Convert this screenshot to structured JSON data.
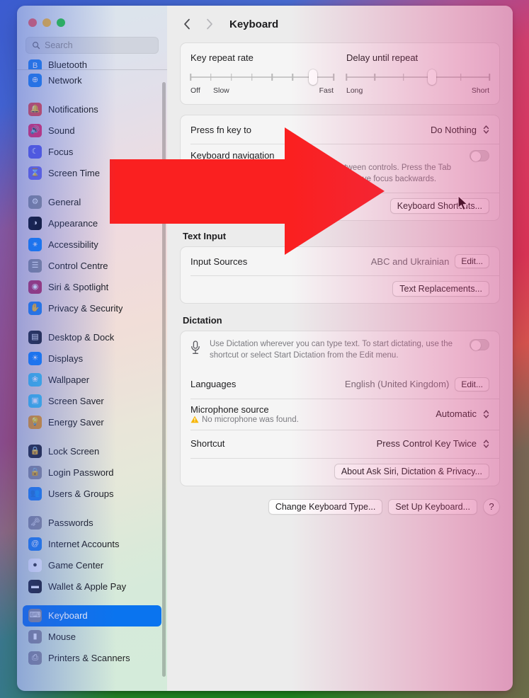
{
  "window": {
    "traffic_lights": [
      "close",
      "minimize",
      "zoom"
    ],
    "accent_color": "#0a74ef",
    "annotation_color": "#fa2020"
  },
  "sidebar": {
    "search": {
      "placeholder": "Search",
      "icon": "search-icon"
    },
    "items": [
      {
        "label": "Bluetooth",
        "icon": "bluetooth-icon",
        "color": "#1b82f0",
        "glyph": "B",
        "clipped": true
      },
      {
        "label": "Network",
        "icon": "globe-icon",
        "color": "#1b82f0",
        "glyph": "⊕"
      },
      {
        "gap": true
      },
      {
        "label": "Notifications",
        "icon": "bell-icon",
        "color": "#f0453f",
        "glyph": "🔔"
      },
      {
        "label": "Sound",
        "icon": "speaker-icon",
        "color": "#f4255e",
        "glyph": "🔊"
      },
      {
        "label": "Focus",
        "icon": "moon-icon",
        "color": "#5a58e8",
        "glyph": "☾"
      },
      {
        "label": "Screen Time",
        "icon": "hourglass-icon",
        "color": "#6a63e8",
        "glyph": "⌛"
      },
      {
        "gap": true
      },
      {
        "label": "General",
        "icon": "gear-icon",
        "color": "#8e8e93",
        "glyph": "⚙"
      },
      {
        "label": "Appearance",
        "icon": "appearance-icon",
        "color": "#000000",
        "glyph": "◑"
      },
      {
        "label": "Accessibility",
        "icon": "accessibility-icon",
        "color": "#0a84ff",
        "glyph": "⚹"
      },
      {
        "label": "Control Centre",
        "icon": "control-centre-icon",
        "color": "#8e8e93",
        "glyph": "☰"
      },
      {
        "label": "Siri & Spotlight",
        "icon": "siri-icon",
        "color": "#c0285a",
        "glyph": "◉"
      },
      {
        "label": "Privacy & Security",
        "icon": "privacy-hand-icon",
        "color": "#1b82f0",
        "glyph": "✋"
      },
      {
        "gap": true
      },
      {
        "label": "Desktop & Dock",
        "icon": "desktop-dock-icon",
        "color": "#1c1c1e",
        "glyph": "▤"
      },
      {
        "label": "Displays",
        "icon": "display-icon",
        "color": "#0a84ff",
        "glyph": "☀"
      },
      {
        "label": "Wallpaper",
        "icon": "wallpaper-icon",
        "color": "#3ec8f0",
        "glyph": "❀"
      },
      {
        "label": "Screen Saver",
        "icon": "screen-saver-icon",
        "color": "#3ec8f0",
        "glyph": "▣"
      },
      {
        "label": "Energy Saver",
        "icon": "energy-saver-icon",
        "color": "#f99a0b",
        "glyph": "💡"
      },
      {
        "gap": true
      },
      {
        "label": "Lock Screen",
        "icon": "lock-screen-icon",
        "color": "#1c1c1e",
        "glyph": "🔒"
      },
      {
        "label": "Login Password",
        "icon": "login-password-icon",
        "color": "#8e8e93",
        "glyph": "🔒"
      },
      {
        "label": "Users & Groups",
        "icon": "users-groups-icon",
        "color": "#1b82f0",
        "glyph": "👥"
      },
      {
        "gap": true
      },
      {
        "label": "Passwords",
        "icon": "key-icon",
        "color": "#8e8e93",
        "glyph": "🗝"
      },
      {
        "label": "Internet Accounts",
        "icon": "at-sign-icon",
        "color": "#1b82f0",
        "glyph": "@"
      },
      {
        "label": "Game Center",
        "icon": "game-center-icon",
        "color": "#ffffff",
        "glyph": "●"
      },
      {
        "label": "Wallet & Apple Pay",
        "icon": "wallet-icon",
        "color": "#1c1c1e",
        "glyph": "▬"
      },
      {
        "gap": true
      },
      {
        "label": "Keyboard",
        "icon": "keyboard-icon",
        "color": "#8e8e93",
        "glyph": "⌨",
        "selected": true
      },
      {
        "label": "Mouse",
        "icon": "mouse-icon",
        "color": "#8e8e93",
        "glyph": "▮"
      },
      {
        "label": "Printers & Scanners",
        "icon": "printer-icon",
        "color": "#8e8e93",
        "glyph": "⎙"
      }
    ]
  },
  "header": {
    "title": "Keyboard",
    "back_icon": "chevron-left-icon",
    "forward_icon": "chevron-right-icon"
  },
  "main": {
    "sliders": [
      {
        "title": "Key repeat rate",
        "left_caption": "Off",
        "second_caption": "Slow",
        "right_caption": "Fast",
        "ticks": 8,
        "value_index": 6
      },
      {
        "title": "Delay until repeat",
        "left_caption": "Long",
        "second_caption": "",
        "right_caption": "Short",
        "ticks": 6,
        "value_index": 3
      }
    ],
    "fn_row": {
      "label": "Press fn key to",
      "value": "Do Nothing"
    },
    "keyboard_navigation": {
      "title": "Keyboard navigation",
      "description": "Use keyboard navigation to move focus between controls. Press the Tab key to move focus forwards and Shift-Tab to move focus backwards.",
      "toggle_state": "off"
    },
    "keyboard_shortcuts_button": "Keyboard Shortcuts...",
    "text_input": {
      "section_title": "Text Input",
      "input_sources_label": "Input Sources",
      "input_sources_value": "ABC and Ukrainian",
      "edit_button": "Edit...",
      "text_replacements_button": "Text Replacements..."
    },
    "dictation": {
      "section_title": "Dictation",
      "description": "Use Dictation wherever you can type text. To start dictating, use the shortcut or select Start Dictation from the Edit menu.",
      "toggle_state": "off",
      "mic_icon": "microphone-icon",
      "languages_label": "Languages",
      "languages_value": "English (United Kingdom)",
      "languages_edit_button": "Edit...",
      "microphone_source_label": "Microphone source",
      "microphone_source_warning": "No microphone was found.",
      "microphone_source_value": "Automatic",
      "shortcut_label": "Shortcut",
      "shortcut_value": "Press Control Key Twice",
      "about_button": "About Ask Siri, Dictation & Privacy..."
    },
    "footer": {
      "change_keyboard_type_button": "Change Keyboard Type...",
      "set_up_keyboard_button": "Set Up Keyboard...",
      "help_button": "?"
    }
  }
}
